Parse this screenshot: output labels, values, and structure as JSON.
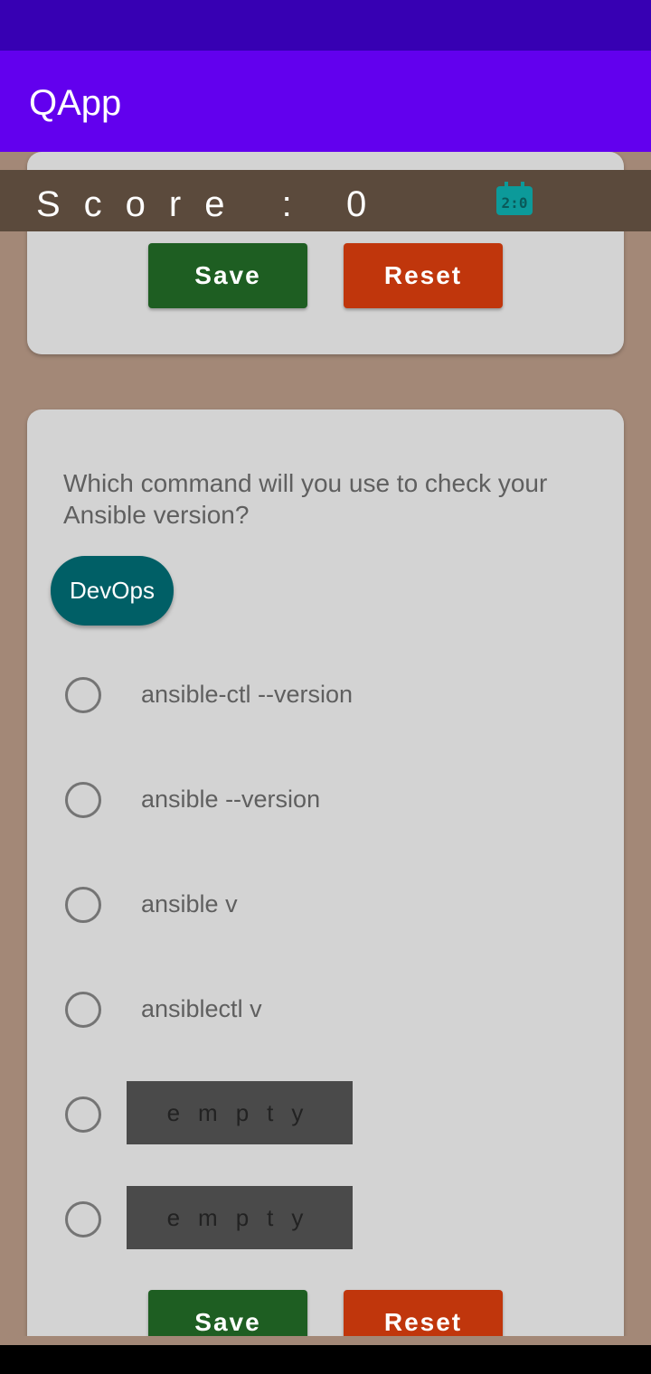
{
  "app": {
    "title": "QApp"
  },
  "score": {
    "label": "Score :",
    "value": "0",
    "icon": "scoreboard-icon"
  },
  "card_top": {
    "save_label": "Save",
    "reset_label": "Reset"
  },
  "question_card": {
    "question": "Which command will you use to check your Ansible version?",
    "category_chip": "DevOps",
    "options": [
      {
        "label": "ansible-ctl --version"
      },
      {
        "label": "ansible --version"
      },
      {
        "label": "ansible v"
      },
      {
        "label": "ansiblectl v"
      },
      {
        "label": "empty"
      },
      {
        "label": "empty"
      }
    ],
    "save_label": "Save",
    "reset_label": "Reset"
  },
  "colors": {
    "status_bar": "#3700b3",
    "app_bar": "#6200ee",
    "background": "#a38877",
    "score_bar": "#5b4a3c",
    "card": "#d3d3d3",
    "save": "#1e5e22",
    "reset": "#c0360c",
    "chip": "#005f66",
    "score_icon": "#0c9a9a"
  }
}
